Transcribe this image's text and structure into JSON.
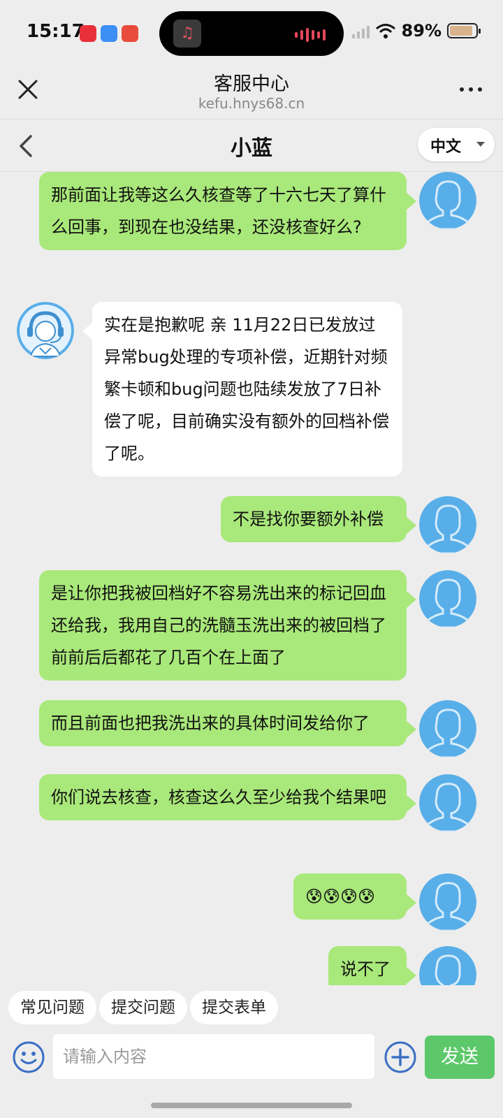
{
  "status_bar": {
    "time": "15:17",
    "battery": "89%",
    "battery_level": 0.89
  },
  "browser": {
    "title": "客服中心",
    "url": "kefu.hnys68.cn"
  },
  "chat": {
    "title": "小蓝",
    "language": "中文"
  },
  "messages": [
    {
      "sender": "user",
      "text": "那前面让我等这么久核查等了十六七天了算什么回事，到现在也没结果，还没核查好么?"
    },
    {
      "sender": "agent",
      "text": "实在是抱歉呢 亲 11月22日已发放过异常bug处理的专项补偿，近期针对频繁卡顿和bug问题也陆续发放了7日补偿了呢，目前确实没有额外的回档补偿了呢。"
    },
    {
      "sender": "user",
      "text": "不是找你要额外补偿"
    },
    {
      "sender": "user",
      "text": "是让你把我被回档好不容易洗出来的标记回血还给我，我用自己的洗髓玉洗出来的被回档了前前后后都花了几百个在上面了"
    },
    {
      "sender": "user",
      "text": "而且前面也把我洗出来的具体时间发给你了"
    },
    {
      "sender": "user",
      "text": "你们说去核查，核查这么久至少给我个结果吧"
    },
    {
      "sender": "user",
      "text": "😰😰😰😰"
    },
    {
      "sender": "user",
      "text": "说不了"
    }
  ],
  "quick_replies": [
    "常见问题",
    "提交问题",
    "提交表单"
  ],
  "input": {
    "placeholder": "请输入内容",
    "send_label": "发送"
  },
  "colors": {
    "user_bubble": "#a9e87a",
    "agent_bubble": "#ffffff",
    "send_button": "#5cc86a",
    "avatar_blue": "#58aee8",
    "background": "#ededed"
  }
}
